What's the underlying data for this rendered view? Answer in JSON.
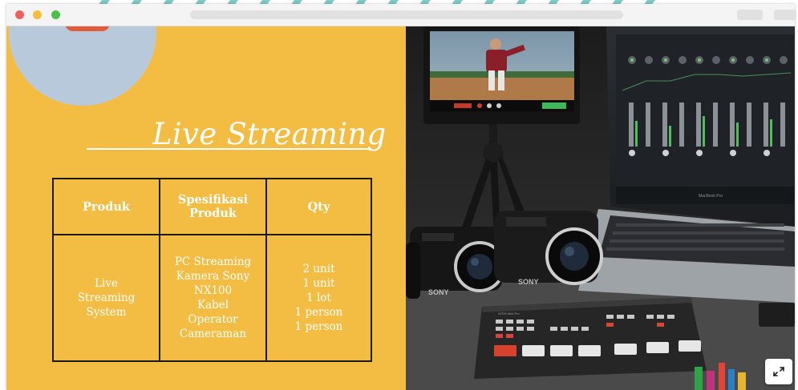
{
  "slide": {
    "title": "Live Streaming",
    "table": {
      "headers": [
        "Produk",
        "Spesifikasi Produk",
        "Qty"
      ],
      "header_lines": [
        [
          "Produk"
        ],
        [
          "Spesifikasi",
          "Produk"
        ],
        [
          "Qty"
        ]
      ],
      "row": {
        "produk_lines": [
          "Live",
          "Streaming",
          "System"
        ],
        "spesifikasi_lines": [
          "PC Streaming",
          "Kamera Sony",
          "NX100",
          "Kabel",
          "Operator",
          "Cameraman"
        ],
        "qty_lines": [
          "2 unit",
          "1 unit",
          "1 lot",
          "1 person",
          "1 person"
        ]
      }
    }
  },
  "photo": {
    "device_labels": [
      "SONY",
      "SONY",
      "ATEM Mini Pro",
      "MacBook Pro"
    ]
  },
  "icons": {
    "expand": "expand-arrows-icon"
  },
  "colors": {
    "slide_background": "#f3bd44",
    "text": "#ffffff",
    "circle": "#b9c9dc",
    "table_border": "#1a1a1a",
    "stripes": "#7ec8c9"
  }
}
